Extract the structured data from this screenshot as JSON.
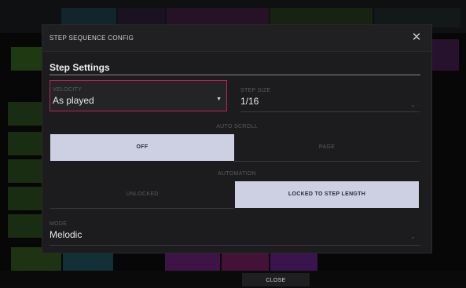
{
  "dialog": {
    "title": "STEP SEQUENCE CONFIG",
    "section_heading": "Step Settings"
  },
  "velocity": {
    "label": "VELOCITY",
    "value": "As played"
  },
  "step_size": {
    "label": "STEP SIZE",
    "value": "1/16"
  },
  "auto_scroll": {
    "label": "AUTO SCROLL",
    "options": [
      "OFF",
      "PAGE"
    ],
    "selected": "OFF"
  },
  "automation": {
    "label": "AUTOMATION",
    "options": [
      "UNLOCKED",
      "LOCKED TO STEP LENGTH"
    ],
    "selected": "LOCKED TO STEP LENGTH"
  },
  "mode": {
    "label": "MODE",
    "value": "Melodic"
  },
  "footer": {
    "close_label": "CLOSE"
  },
  "icons": {
    "close": "close-icon",
    "dropdown": "chevron-down-icon"
  },
  "colors": {
    "accent_border": "#c21e5a",
    "selected_segment": "#ccd0e2",
    "modal_bg": "#1c1c1e"
  }
}
